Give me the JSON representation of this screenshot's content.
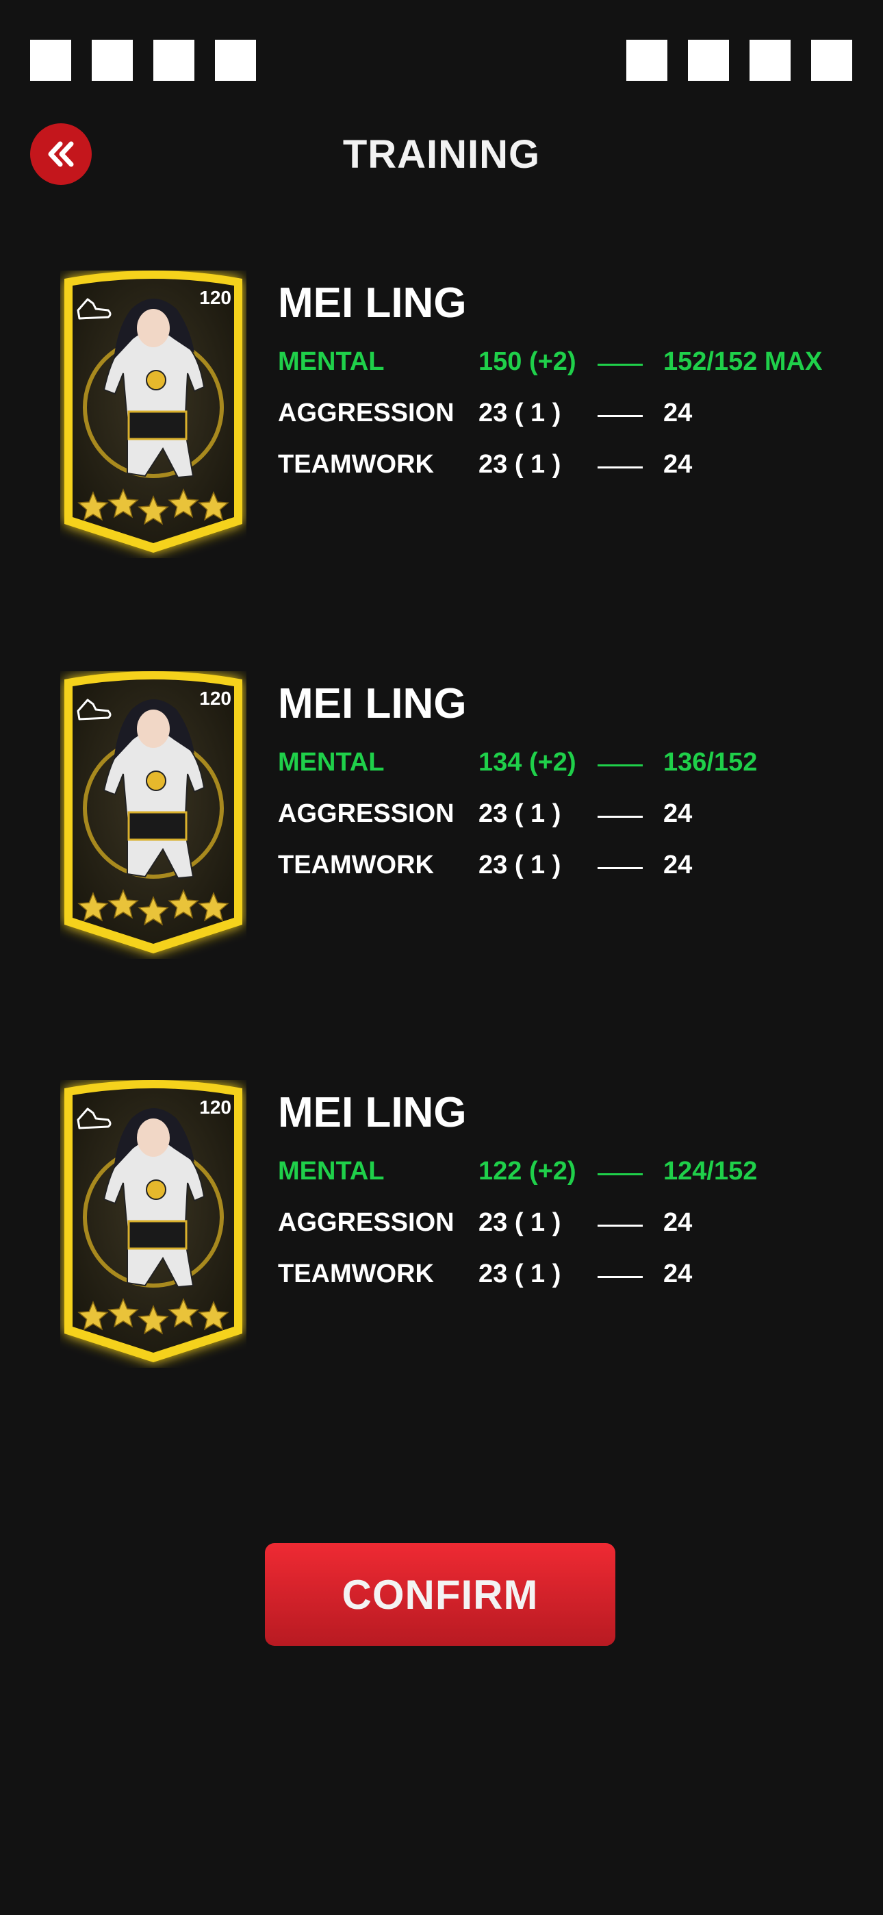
{
  "status_bar": {
    "left_icons": 4,
    "right_icons": 4
  },
  "header": {
    "back_icon": "double-chevron-left-icon",
    "title": "TRAINING"
  },
  "players": [
    {
      "level": "120",
      "stars": 5,
      "name": "MEI LING",
      "stats": [
        {
          "name": "MENTAL",
          "value": "150 (+2)",
          "result": "152/152  MAX",
          "color": "#1fd04a"
        },
        {
          "name": "AGGRESSION",
          "value": "23 ( 1 )",
          "result": "24",
          "color": "#ffffff"
        },
        {
          "name": "TEAMWORK",
          "value": "23 ( 1 )",
          "result": "24",
          "color": "#ffffff"
        }
      ]
    },
    {
      "level": "120",
      "stars": 5,
      "name": "MEI LING",
      "stats": [
        {
          "name": "MENTAL",
          "value": "134 (+2)",
          "result": "136/152",
          "color": "#1fd04a"
        },
        {
          "name": "AGGRESSION",
          "value": "23 ( 1 )",
          "result": "24",
          "color": "#ffffff"
        },
        {
          "name": "TEAMWORK",
          "value": "23 ( 1 )",
          "result": "24",
          "color": "#ffffff"
        }
      ]
    },
    {
      "level": "120",
      "stars": 5,
      "name": "MEI LING",
      "stats": [
        {
          "name": "MENTAL",
          "value": "122 (+2)",
          "result": "124/152",
          "color": "#1fd04a"
        },
        {
          "name": "AGGRESSION",
          "value": "23 ( 1 )",
          "result": "24",
          "color": "#ffffff"
        },
        {
          "name": "TEAMWORK",
          "value": "23 ( 1 )",
          "result": "24",
          "color": "#ffffff"
        }
      ]
    }
  ],
  "confirm_label": "CONFIRM",
  "colors": {
    "accent_red": "#c4161c",
    "stat_green": "#1fd04a",
    "card_gold": "#f5d21c",
    "background": "#121212"
  }
}
